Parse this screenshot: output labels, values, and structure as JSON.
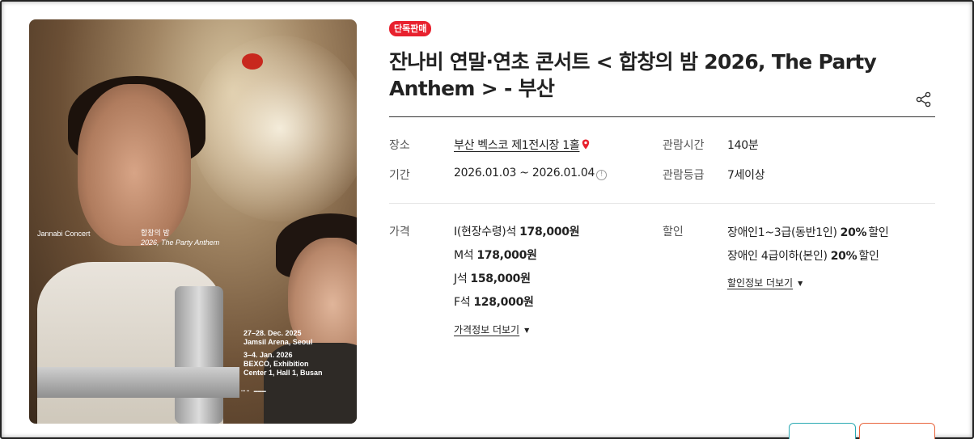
{
  "badge": "단독판매",
  "title": "잔나비 연말·연초 콘서트 < 합창의 밤 2026, The Party Anthem > - 부산",
  "poster": {
    "brand": "Jannabi Concert",
    "title_ko": "합창의 밤",
    "title_en": "2026, The Party Anthem",
    "date1": "27–28. Dec. 2025",
    "venue1": "Jamsil Arena, Seoul",
    "date2": "3–4. Jan. 2026",
    "venue2a": "BEXCO, Exhibition",
    "venue2b": "Center 1, Hall 1, Busan"
  },
  "details": {
    "venue_label": "장소",
    "venue_value": "부산 벡스코 제1전시장 1홀",
    "period_label": "기간",
    "period_value": "2026.01.03 ~ 2026.01.04",
    "runtime_label": "관람시간",
    "runtime_value": "140분",
    "rating_label": "관람등급",
    "rating_value": "7세이상"
  },
  "price": {
    "label": "가격",
    "rows": [
      {
        "seat": "I(현장수령)석",
        "amount": "178,000원"
      },
      {
        "seat": "M석",
        "amount": "178,000원"
      },
      {
        "seat": "J석",
        "amount": "158,000원"
      },
      {
        "seat": "F석",
        "amount": "128,000원"
      }
    ],
    "more": "가격정보 더보기"
  },
  "discount": {
    "label": "할인",
    "rows": [
      {
        "target": "장애인1~3급(동반1인)",
        "rate": "20%",
        "suffix": "할인"
      },
      {
        "target": "장애인 4급이하(본인)",
        "rate": "20%",
        "suffix": "할인"
      }
    ],
    "more": "할인정보 더보기"
  },
  "icons": {
    "share": "share-icon",
    "pin": "map-pin-icon",
    "info": "info-icon",
    "arrow": "caret-down-icon"
  },
  "colors": {
    "badge": "#e8212e",
    "pin": "#e8212e",
    "btn_a_border": "#2aa9b3",
    "btn_b_border": "#e8643c"
  }
}
